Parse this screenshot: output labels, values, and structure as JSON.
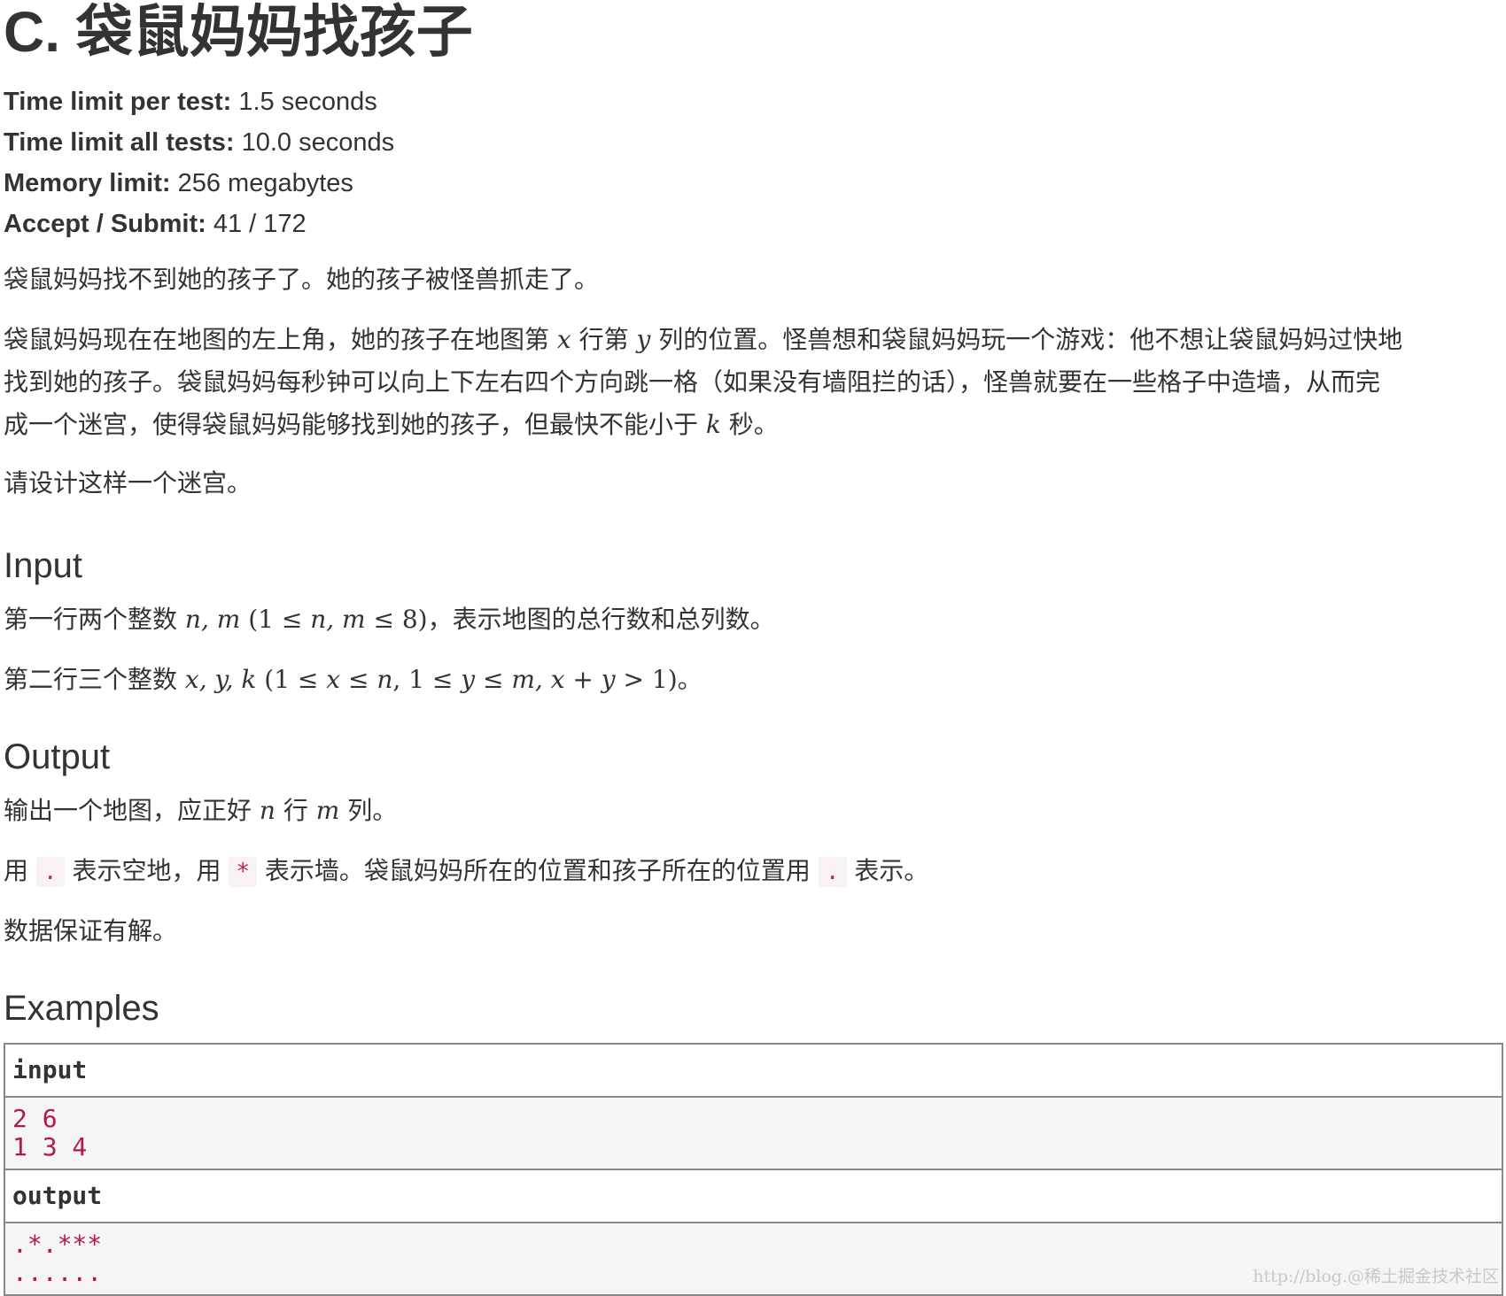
{
  "problem": {
    "title": "C. 袋鼠妈妈找孩子",
    "meta": [
      {
        "label": "Time limit per test:",
        "value": " 1.5 seconds"
      },
      {
        "label": "Time limit all tests:",
        "value": " 10.0 seconds"
      },
      {
        "label": "Memory limit:",
        "value": " 256 megabytes"
      },
      {
        "label": "Accept / Submit:",
        "value": " 41 / 172"
      }
    ],
    "intro": "袋鼠妈妈找不到她的孩子了。她的孩子被怪兽抓走了。",
    "desc_line1_a": "袋鼠妈妈现在在地图的左上角，她的孩子在地图第 ",
    "desc_line1_x": "x",
    "desc_line1_b": " 行第 ",
    "desc_line1_y": "y",
    "desc_line1_c": " 列的位置。怪兽想和袋鼠妈妈玩一个游戏：他不想让袋鼠妈妈过快地",
    "desc_line2": "找到她的孩子。袋鼠妈妈每秒钟可以向上下左右四个方向跳一格（如果没有墙阻拦的话），怪兽就要在一些格子中造墙，从而完",
    "desc_line3_a": "成一个迷宫，使得袋鼠妈妈能够找到她的孩子，但最快不能小于 ",
    "desc_line3_k": "k",
    "desc_line3_b": " 秒。",
    "design": "请设计这样一个迷宫。"
  },
  "input_section": {
    "heading": "Input",
    "line1_a": "第一行两个整数 ",
    "line1_math": "n, m",
    "line1_math2": " (1 ≤ ",
    "line1_math3": "n, m",
    "line1_math4": " ≤ 8)",
    "line1_b": "，表示地图的总行数和总列数。",
    "line2_a": "第二行三个整数 ",
    "line2_math": "x, y, k",
    "line2_math2": " (1 ≤ ",
    "line2_math3": "x",
    "line2_math4": " ≤ ",
    "line2_math5": "n",
    "line2_math6": ", 1 ≤ ",
    "line2_math7": "y",
    "line2_math8": " ≤ ",
    "line2_math9": "m, x",
    "line2_math10": " + ",
    "line2_math11": "y",
    "line2_math12": " > 1)",
    "line2_b": "。"
  },
  "output_section": {
    "heading": "Output",
    "line1_a": "输出一个地图，应正好 ",
    "line1_n": "n",
    "line1_b": " 行 ",
    "line1_m": "m",
    "line1_c": " 列。",
    "line2_a": "用 ",
    "line2_code1": ".",
    "line2_b": " 表示空地，用 ",
    "line2_code2": "*",
    "line2_c": " 表示墙。袋鼠妈妈所在的位置和孩子所在的位置用 ",
    "line2_code3": ".",
    "line2_d": " 表示。",
    "guarantee": "数据保证有解。"
  },
  "examples": {
    "heading": "Examples",
    "input_label": "input",
    "input_text": "2 6\n1 3 4",
    "output_label": "output",
    "output_text": ".*.***\n......"
  },
  "watermark": "http://blog.@稀土掘金技术社区"
}
